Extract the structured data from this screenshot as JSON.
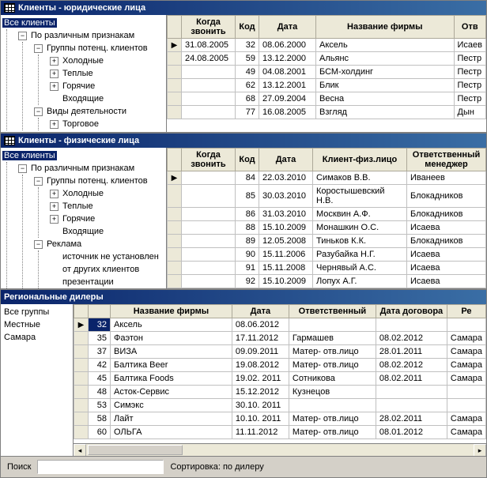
{
  "panel1": {
    "title": "Клиенты - юридические лица",
    "tree": {
      "root": "Все клиенты",
      "n1": "По различным признакам",
      "n1_1": "Группы потенц. клиентов",
      "n1_1_1": "Холодные",
      "n1_1_2": "Теплые",
      "n1_1_3": "Горячие",
      "n1_1_4": "Входящие",
      "n1_2": "Виды деятельности",
      "n1_2_1": "Торговое"
    },
    "cols": {
      "c0": "Когда звонить",
      "c1": "Код",
      "c2": "Дата",
      "c3": "Название фирмы",
      "c4": "Отв"
    },
    "rows": [
      {
        "call": "31.08.2005",
        "code": "32",
        "date": "08.06.2000",
        "name": "Аксель",
        "resp": "Исаев"
      },
      {
        "call": "24.08.2005",
        "code": "59",
        "date": "13.12.2000",
        "name": "Альянс",
        "resp": "Пестр"
      },
      {
        "call": "",
        "code": "49",
        "date": "04.08.2001",
        "name": "БСМ-холдинг",
        "resp": "Пестр"
      },
      {
        "call": "",
        "code": "62",
        "date": "13.12.2001",
        "name": "Блик",
        "resp": "Пестр"
      },
      {
        "call": "",
        "code": "68",
        "date": "27.09.2004",
        "name": "Весна",
        "resp": "Пестр"
      },
      {
        "call": "",
        "code": "77",
        "date": "16.08.2005",
        "name": "Взгляд",
        "resp": "Дын"
      }
    ]
  },
  "panel2": {
    "title": "Клиенты - физические лица",
    "tree": {
      "root": "Все клиенты",
      "n1": "По различным признакам",
      "n1_1": "Группы потенц. клиентов",
      "n1_1_1": "Холодные",
      "n1_1_2": "Теплые",
      "n1_1_3": "Горячие",
      "n1_1_4": "Входящие",
      "n1_2": "Реклама",
      "n1_2_1": "источник не установлен",
      "n1_2_2": "от других клиентов",
      "n1_2_3": "презентации"
    },
    "cols": {
      "c0": "Когда звонить",
      "c1": "Код",
      "c2": "Дата",
      "c3": "Клиент-физ.лицо",
      "c4": "Ответственный менеджер"
    },
    "rows": [
      {
        "call": "",
        "code": "84",
        "date": "22.03.2010",
        "name": "Симаков В.В.",
        "resp": "Иванеев"
      },
      {
        "call": "",
        "code": "85",
        "date": "30.03.2010",
        "name": "Коростышевский Н.В.",
        "resp": "Блокадников"
      },
      {
        "call": "",
        "code": "86",
        "date": "31.03.2010",
        "name": "Москвин А.Ф.",
        "resp": "Блокадников"
      },
      {
        "call": "",
        "code": "88",
        "date": "15.10.2009",
        "name": "Монашкин О.С.",
        "resp": "Исаева"
      },
      {
        "call": "",
        "code": "89",
        "date": "12.05.2008",
        "name": "Тиньков К.К.",
        "resp": "Блокадников"
      },
      {
        "call": "",
        "code": "90",
        "date": "15.11.2006",
        "name": "Разубайка Н.Г.",
        "resp": "Исаева"
      },
      {
        "call": "",
        "code": "91",
        "date": "15.11.2008",
        "name": "Чернявый А.С.",
        "resp": "Исаева"
      },
      {
        "call": "",
        "code": "92",
        "date": "15.10.2009",
        "name": "Лопух А.Г.",
        "resp": "Исаева"
      }
    ]
  },
  "panel3": {
    "title": "Региональные дилеры",
    "tree": {
      "t1": "Все группы",
      "t2": "Местные",
      "t3": "Самара"
    },
    "cols": {
      "c0": "",
      "c1": "Название фирмы",
      "c2": "Дата",
      "c3": "Ответственный",
      "c4": "Дата договора",
      "c5": "Ре"
    },
    "rows": [
      {
        "code": "32",
        "name": "Аксель",
        "date": "08.06.2012",
        "resp": "",
        "contract": "",
        "reg": ""
      },
      {
        "code": "35",
        "name": "Фаэтон",
        "date": "17.11.2012",
        "resp": "Гармашев",
        "contract": "08.02.2012",
        "reg": "Самара"
      },
      {
        "code": "37",
        "name": "ВИЗА",
        "date": "09.09.2011",
        "resp": "Матер- отв.лицо",
        "contract": "28.01.2011",
        "reg": "Самара"
      },
      {
        "code": "42",
        "name": "Балтика Beer",
        "date": "19.08.2012",
        "resp": "Матер- отв.лицо",
        "contract": "08.02.2012",
        "reg": "Самара"
      },
      {
        "code": "45",
        "name": "Балтика Foods",
        "date": "19.02. 2011",
        "resp": "Сотникова",
        "contract": "08.02.2011",
        "reg": "Самара"
      },
      {
        "code": "48",
        "name": "Асток-Сервис",
        "date": "15.12.2012",
        "resp": "Кузнецов",
        "contract": "",
        "reg": ""
      },
      {
        "code": "53",
        "name": "Симэкс",
        "date": "30.10. 2011",
        "resp": "",
        "contract": "",
        "reg": ""
      },
      {
        "code": "58",
        "name": "Лайт",
        "date": "10.10. 2011",
        "resp": "Матер- отв.лицо",
        "contract": "28.02.2011",
        "reg": "Самара"
      },
      {
        "code": "60",
        "name": "ОЛЬГА",
        "date": "11.11.2012",
        "resp": "Матер- отв.лицо",
        "contract": "08.01.2012",
        "reg": "Самара"
      }
    ]
  },
  "footer": {
    "search_label": "Поиск",
    "search_value": "",
    "sort_label": "Сортировка: по дилеру"
  }
}
